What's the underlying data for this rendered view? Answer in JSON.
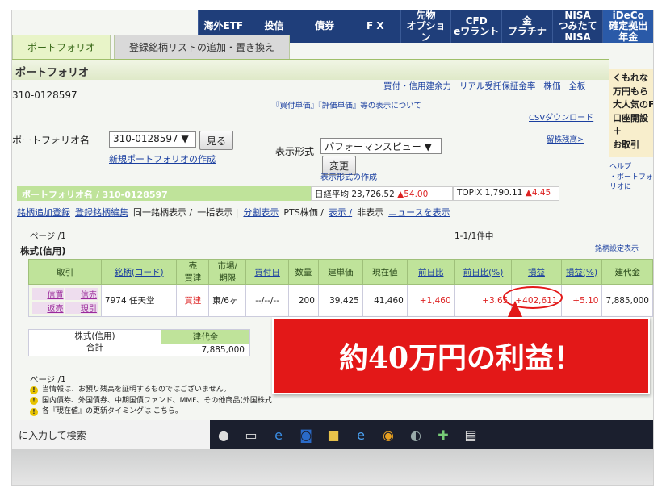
{
  "nav": [
    "海外ETF",
    "投信",
    "債券",
    "F X",
    "先物\nオプション",
    "CFD\neワラント",
    "金\nプラチナ",
    "NISA\nつみたてNISA",
    "iDeCo\n確定拠出年金"
  ],
  "tabs": {
    "portfolio": "ポートフォリオ",
    "register": "登録銘柄リストの追加・置き換え"
  },
  "section_title": "ポートフォリオ",
  "account_no": "310-0128597",
  "top_links": [
    "買付・信用建余力",
    "リアル受託保証金率",
    "株価",
    "全板"
  ],
  "notice": "『買付単価』『評価単価』等の表示について",
  "csv": "CSVダウンロード",
  "pf_name_label": "ポートフォリオ名",
  "pf_select": "310-0128597 ▼",
  "see_btn": "見る",
  "new_pf": "新規ポートフォリオの作成",
  "display_label": "表示形式",
  "display_select": "パフォーマンスビュー ▼",
  "change_btn": "変更",
  "create_display": "表示形式の作成",
  "remaining": "留株残高>",
  "side_ad": "くもれな\n万円もら\n大人気のF\n口座開設＋\nお取引",
  "side_help": "ヘルプ\n・ポートフォリオに",
  "pf_bar": "ポートフォリオ名 / 310-0128597",
  "nikkei": {
    "label": "日経平均",
    "value": "23,726.52",
    "change": "▲54.00"
  },
  "topix": {
    "label": "TOPIX",
    "value": "1,790.11",
    "change": "▲4.45"
  },
  "toolbar": [
    "銘柄追加登録",
    "登録銘柄編集",
    "同一銘柄表示 /",
    "一括表示 |",
    "分割表示",
    "PTS株価 /",
    "表示 /",
    "非表示",
    "ニュースを表示"
  ],
  "page_label": "ページ /1",
  "paging": "1-1/1件中",
  "stock_type": "株式(信用)",
  "settings": "銘柄設定表示",
  "headers": [
    "取引",
    "銘柄(コード)",
    "売\n買建",
    "市場/\n期限",
    "買付日",
    "数量",
    "建単価",
    "現在値",
    "前日比",
    "前日比(%)",
    "損益",
    "損益(%)",
    "建代金"
  ],
  "row": {
    "trade": [
      "信買",
      "信売",
      "返売",
      "現引"
    ],
    "name": "7974 任天堂",
    "side": "買建",
    "market": "東/6ヶ",
    "date": "--/--/--",
    "qty": "200",
    "price": "39,425",
    "current": "41,460",
    "change": "+1,460",
    "change_pct": "+3.65",
    "pnl": "+402,611",
    "pnl_pct": "+5.10",
    "amount": "7,885,000"
  },
  "summary": {
    "label1": "株式(信用)",
    "label2": "合計",
    "head": "建代金",
    "value": "7,885,000"
  },
  "notes": [
    "当情報は、お預り残高を証明するものではございません。",
    "国内債券、外国債券、中期国債ファンド、MMF、その他商品(外国株式",
    "各『現在値』の更新タイミングは こちら。"
  ],
  "search": "に入力して検索",
  "banner": "約40万円の利益！"
}
